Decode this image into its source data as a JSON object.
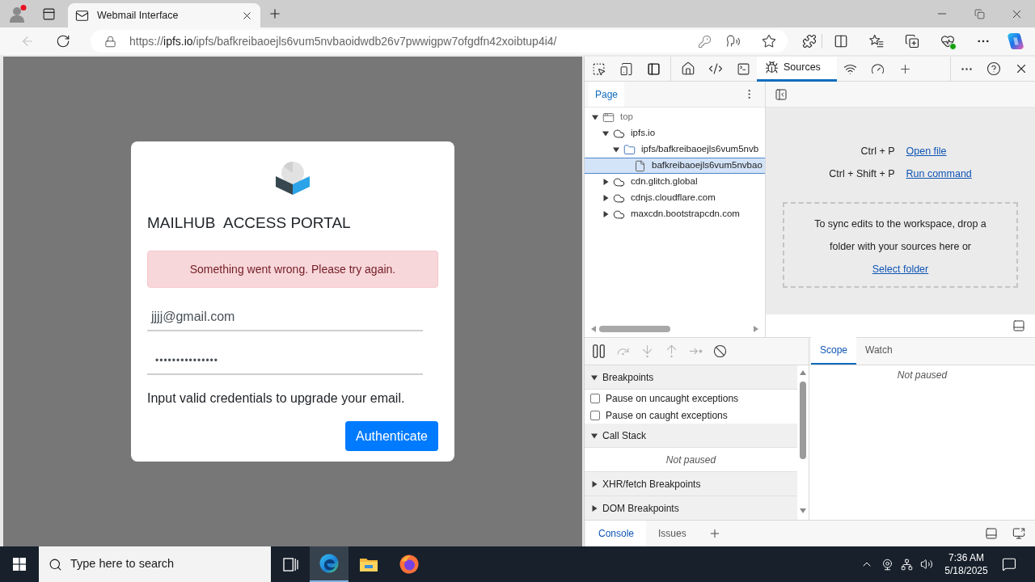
{
  "browser": {
    "tabs": [
      {
        "title": "Webmail Interface",
        "selected": true
      }
    ],
    "navigation": [
      {
        "kind": "back",
        "disabled": true
      },
      {
        "kind": "reload",
        "disabled": false
      }
    ],
    "address": {
      "scheme": "https://",
      "host": "ipfs.io",
      "path": "/ipfs/bafkreibaoejls6vum5nvbaoidwdb26v7pwwigpw7ofgdfn42xoibtup4i4/"
    }
  },
  "page": {
    "title": "MAILHUB  ACCESS PORTAL",
    "alert": "Something went wrong. Please try again.",
    "email": {
      "value": "jjjj@gmail.com"
    },
    "password": {
      "value": "•••••••••••••••"
    },
    "note": "Input valid credentials to upgrade your email.",
    "submit": "Authenticate"
  },
  "devtools": {
    "tabs": [
      {
        "label": "Sources",
        "selected": true
      }
    ],
    "navigator": {
      "tabs": [
        {
          "label": "Page",
          "selected": true
        }
      ],
      "tree": [
        {
          "label": "top",
          "kind": "frame",
          "expanded": true,
          "selected": false,
          "children": [
            {
              "label": "ipfs.io",
              "kind": "domain",
              "expanded": true,
              "selected": false,
              "children": [
                {
                  "label": "ipfs/bafkreibaoejls6vum5nvb",
                  "kind": "folder",
                  "expanded": true,
                  "selected": false,
                  "children": [
                    {
                      "label": "bafkreibaoejls6vum5nvbao",
                      "kind": "file",
                      "selected": true
                    }
                  ]
                }
              ]
            },
            {
              "label": "cdn.glitch.global",
              "kind": "domain",
              "expanded": false,
              "selected": false
            },
            {
              "label": "cdnjs.cloudflare.com",
              "kind": "domain",
              "expanded": false,
              "selected": false
            },
            {
              "label": "maxcdn.bootstrapcdn.com",
              "kind": "domain",
              "expanded": false,
              "selected": false
            }
          ]
        }
      ]
    },
    "editor": {
      "shortcuts": [
        {
          "keys": "Ctrl + P",
          "action": "Open file"
        },
        {
          "keys": "Ctrl + Shift + P",
          "action": "Run command"
        }
      ],
      "drop_text": "To sync edits to the workspace, drop a folder with your sources here or",
      "drop_link": "Select folder"
    },
    "debugger": {
      "controls": [
        {
          "kind": "pause",
          "disabled": false
        },
        {
          "kind": "step-over",
          "disabled": true
        },
        {
          "kind": "step-into",
          "disabled": true
        },
        {
          "kind": "step-out",
          "disabled": true
        },
        {
          "kind": "step",
          "disabled": true
        },
        {
          "kind": "deactivate",
          "disabled": false
        }
      ],
      "sections": [
        {
          "kind": "section",
          "label": "Breakpoints",
          "expanded": true
        },
        {
          "kind": "checkbox",
          "label": "Pause on uncaught exceptions",
          "checked": false
        },
        {
          "kind": "checkbox",
          "label": "Pause on caught exceptions",
          "checked": false
        },
        {
          "kind": "section",
          "label": "Call Stack",
          "expanded": true
        },
        {
          "kind": "message",
          "label": "Not paused"
        },
        {
          "kind": "section",
          "label": "XHR/fetch Breakpoints",
          "expanded": false
        },
        {
          "kind": "section",
          "label": "DOM Breakpoints",
          "expanded": false
        }
      ]
    },
    "sidebar": {
      "tabs": [
        {
          "label": "Scope",
          "selected": true
        },
        {
          "label": "Watch",
          "selected": false
        }
      ],
      "message": "Not paused"
    },
    "drawer": {
      "tabs": [
        {
          "label": "Console",
          "selected": true
        },
        {
          "label": "Issues",
          "selected": false
        }
      ]
    }
  },
  "taskbar": {
    "search": {
      "placeholder": "Type here to search"
    },
    "clock": {
      "time": "7:36 AM",
      "date": "5/18/2025"
    }
  }
}
